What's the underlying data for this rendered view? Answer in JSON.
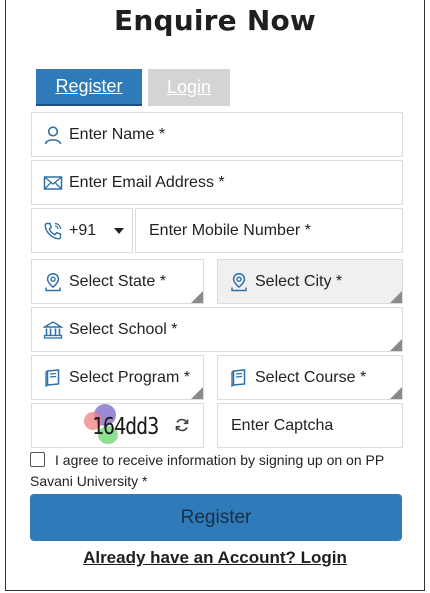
{
  "heading": "Enquire Now",
  "tabs": {
    "register": "Register",
    "login": "Login"
  },
  "fields": {
    "name": "Enter Name *",
    "email": "Enter Email Address *",
    "country_code": "+91",
    "mobile": "Enter Mobile Number *",
    "state": "Select State *",
    "city": "Select City *",
    "school": "Select School *",
    "program": "Select Program *",
    "course": "Select Course *",
    "captcha_code": "164dd3",
    "captcha_input": "Enter Captcha"
  },
  "consent": {
    "text": "I agree to receive information by signing up on on PP Savani University *",
    "checked": false
  },
  "register_button": "Register",
  "login_link": "Already have an Account? Login",
  "colors": {
    "primary": "#2f7ab8",
    "tab_inactive": "#d4d4d4",
    "icon": "#2f6fa8"
  }
}
